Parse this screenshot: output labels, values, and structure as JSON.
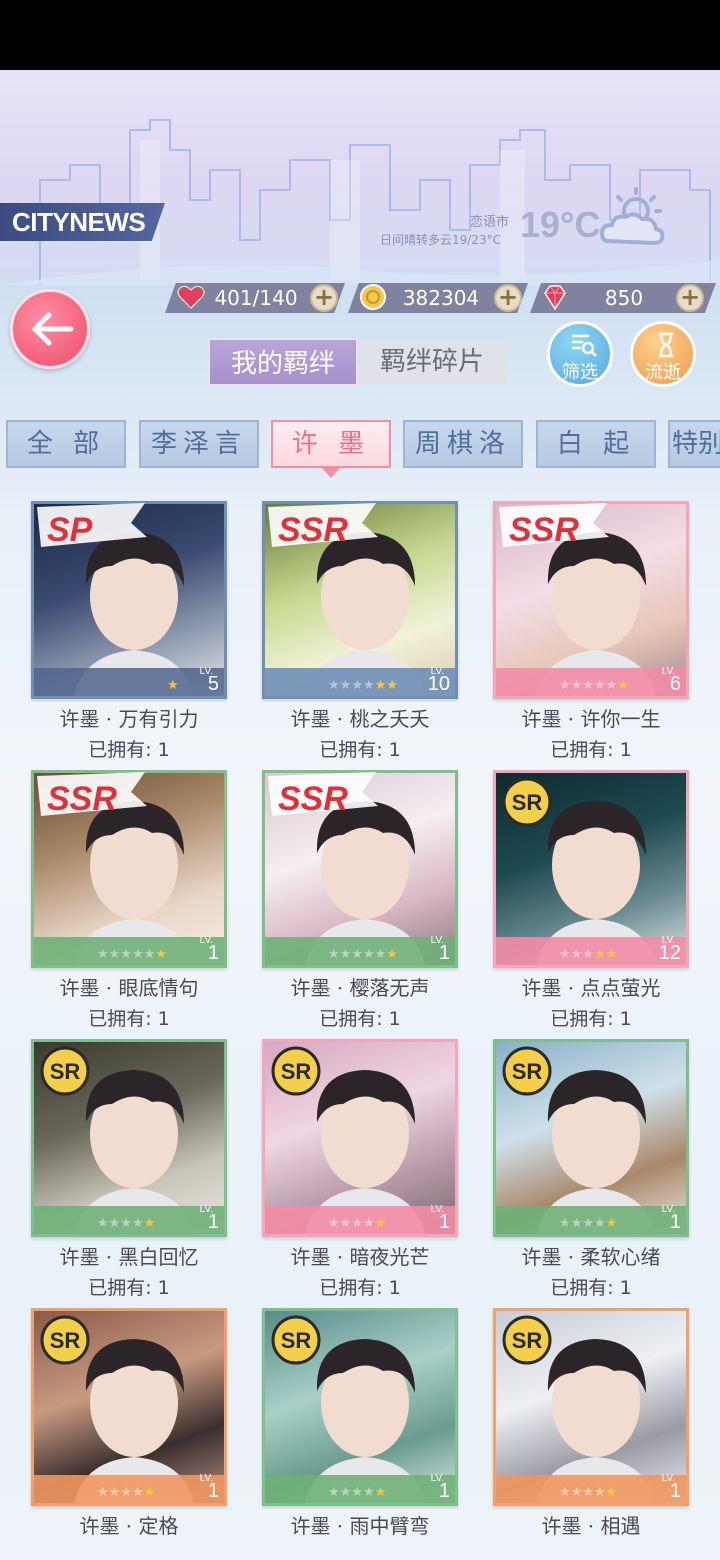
{
  "banner": {
    "brand": "CITYNEWS",
    "city": "恋语市",
    "weather_desc": "日间晴转多云19/23°C",
    "temperature": "19°C"
  },
  "resources": {
    "stamina": "401/140",
    "coins": "382304",
    "diamonds": "850"
  },
  "tabs": {
    "my_bonds": "我的羁绊",
    "bond_fragments": "羁绊碎片"
  },
  "buttons": {
    "filter": "筛选",
    "time_flow": "流逝"
  },
  "categories": [
    "全 部",
    "李泽言",
    "许 墨",
    "周棋洛",
    "白 起",
    "特别"
  ],
  "active_category_index": 2,
  "cards": [
    {
      "name": "许墨 · 万有引力",
      "owned": "已拥有: 1",
      "rarity": "SP",
      "level": "5",
      "stars": 1,
      "stars_total": 1
    },
    {
      "name": "许墨 · 桃之夭夭",
      "owned": "已拥有: 1",
      "rarity": "SSR",
      "level": "10",
      "stars": 2,
      "stars_total": 6
    },
    {
      "name": "许墨 · 许你一生",
      "owned": "已拥有: 1",
      "rarity": "SSR",
      "level": "6",
      "stars": 1,
      "stars_total": 6
    },
    {
      "name": "许墨 · 眼底情句",
      "owned": "已拥有: 1",
      "rarity": "SSR",
      "level": "1",
      "stars": 1,
      "stars_total": 6
    },
    {
      "name": "许墨 · 樱落无声",
      "owned": "已拥有: 1",
      "rarity": "SSR",
      "level": "1",
      "stars": 1,
      "stars_total": 6
    },
    {
      "name": "许墨 · 点点萤光",
      "owned": "已拥有: 1",
      "rarity": "SR",
      "level": "12",
      "stars": 2,
      "stars_total": 5
    },
    {
      "name": "许墨 · 黑白回忆",
      "owned": "已拥有: 1",
      "rarity": "SR",
      "level": "1",
      "stars": 1,
      "stars_total": 5
    },
    {
      "name": "许墨 · 暗夜光芒",
      "owned": "已拥有: 1",
      "rarity": "SR",
      "level": "1",
      "stars": 1,
      "stars_total": 5
    },
    {
      "name": "许墨 · 柔软心绪",
      "owned": "已拥有: 1",
      "rarity": "SR",
      "level": "1",
      "stars": 1,
      "stars_total": 5
    },
    {
      "name": "许墨 · 定格",
      "owned": "",
      "rarity": "SR",
      "level": "1",
      "stars": 1,
      "stars_total": 5
    },
    {
      "name": "许墨 · 雨中臂弯",
      "owned": "",
      "rarity": "SR",
      "level": "1",
      "stars": 1,
      "stars_total": 5
    },
    {
      "name": "许墨 · 相遇",
      "owned": "",
      "rarity": "SR",
      "level": "1",
      "stars": 1,
      "stars_total": 5
    }
  ],
  "lv_label": "LV.",
  "colors": {
    "frame_blue": "#6f8fb6",
    "frame_pink": "#f2a6b8",
    "frame_green": "#7fbf8a",
    "frame_orange": "#f0a06a",
    "accent_pink": "#f06f88",
    "tab_purple": "#a691cb"
  }
}
